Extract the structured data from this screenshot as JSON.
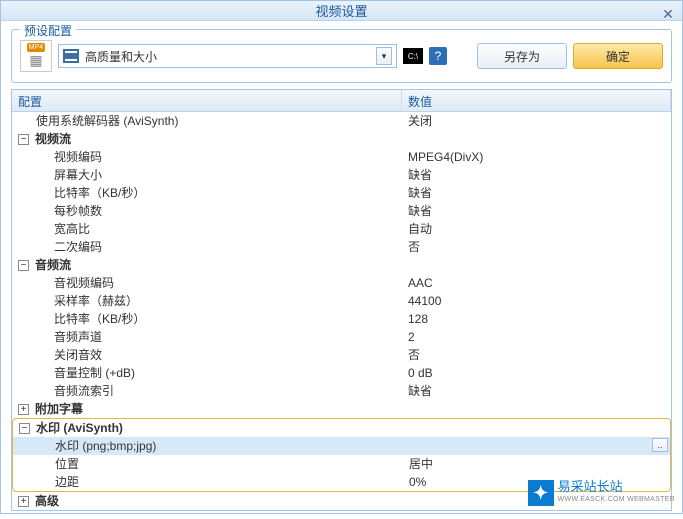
{
  "window": {
    "title": "视频设置"
  },
  "preset": {
    "legend": "预设配置",
    "icon_badge": "MP4",
    "selected": "高质量和大小",
    "cmd_label": "C:\\",
    "save_as": "另存为",
    "ok": "确定"
  },
  "grid": {
    "headers": {
      "config": "配置",
      "value": "数值"
    },
    "rows": [
      {
        "type": "item",
        "indent": 1,
        "label": "使用系统解码器 (AviSynth)",
        "value": "关闭"
      },
      {
        "type": "group",
        "expanded": true,
        "label": "视频流"
      },
      {
        "type": "item",
        "indent": 2,
        "label": "视频编码",
        "value": "MPEG4(DivX)"
      },
      {
        "type": "item",
        "indent": 2,
        "label": "屏幕大小",
        "value": "缺省"
      },
      {
        "type": "item",
        "indent": 2,
        "label": "比特率（KB/秒）",
        "value": "缺省"
      },
      {
        "type": "item",
        "indent": 2,
        "label": "每秒帧数",
        "value": "缺省"
      },
      {
        "type": "item",
        "indent": 2,
        "label": "宽高比",
        "value": "自动"
      },
      {
        "type": "item",
        "indent": 2,
        "label": "二次编码",
        "value": "否"
      },
      {
        "type": "group",
        "expanded": true,
        "label": "音频流"
      },
      {
        "type": "item",
        "indent": 2,
        "label": "音视频编码",
        "value": "AAC"
      },
      {
        "type": "item",
        "indent": 2,
        "label": "采样率（赫兹）",
        "value": "44100"
      },
      {
        "type": "item",
        "indent": 2,
        "label": "比特率（KB/秒）",
        "value": "128"
      },
      {
        "type": "item",
        "indent": 2,
        "label": "音频声道",
        "value": "2"
      },
      {
        "type": "item",
        "indent": 2,
        "label": "关闭音效",
        "value": "否"
      },
      {
        "type": "item",
        "indent": 2,
        "label": "音量控制 (+dB)",
        "value": "0 dB"
      },
      {
        "type": "item",
        "indent": 2,
        "label": "音频流索引",
        "value": "缺省"
      },
      {
        "type": "group",
        "expanded": false,
        "label": "附加字幕"
      },
      {
        "type": "group",
        "expanded": true,
        "label": "水印 (AviSynth)",
        "highlighted": true
      },
      {
        "type": "item",
        "indent": 2,
        "label": "水印 (png;bmp;jpg)",
        "value": "",
        "selected": true,
        "highlighted": true
      },
      {
        "type": "item",
        "indent": 2,
        "label": "位置",
        "value": "居中",
        "highlighted": true
      },
      {
        "type": "item",
        "indent": 2,
        "label": "边距",
        "value": "0%",
        "highlighted": true
      },
      {
        "type": "group",
        "expanded": false,
        "label": "高级"
      }
    ]
  },
  "watermark": {
    "text": "易采站长站",
    "sub": "WWW.EASCK.COM WEBMASTER"
  }
}
